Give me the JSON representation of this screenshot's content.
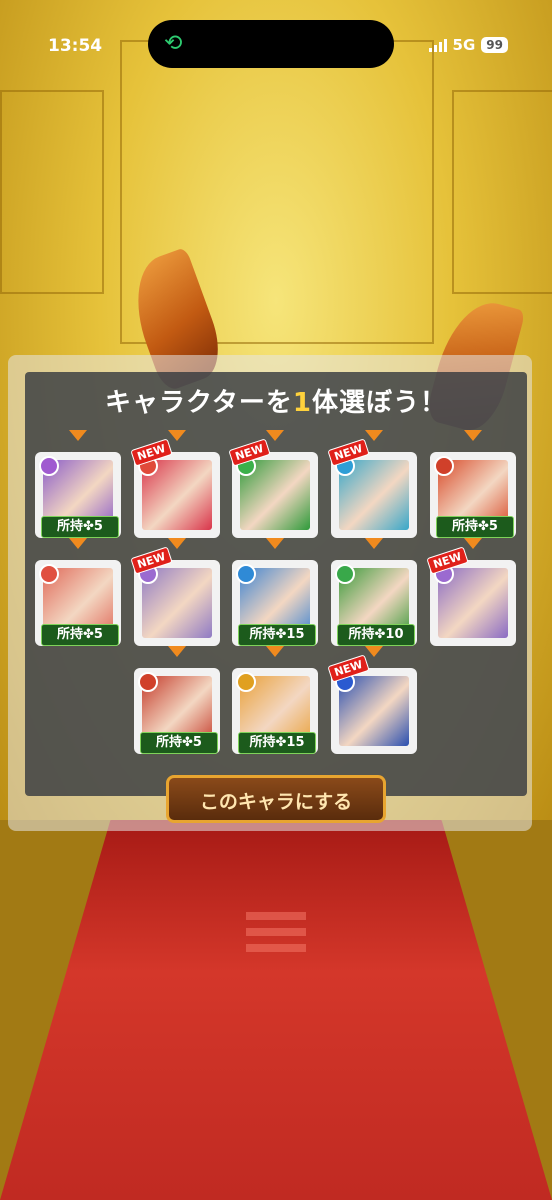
{
  "status_bar": {
    "time": "13:54",
    "network": "5G",
    "battery": "99",
    "island_icon": "app-activity-icon"
  },
  "dialog": {
    "title_before": "キャラクターを",
    "title_number": "1",
    "title_after": "体選ぼう！",
    "select_button": "このキャラにする"
  },
  "characters": [
    {
      "name": "char-1",
      "owned": "所持✤5",
      "new": false,
      "color": "#8a5cc9",
      "orb": "#a05ad0"
    },
    {
      "name": "char-2",
      "owned": "",
      "new": true,
      "color": "#d9344a",
      "orb": "#e04a3a"
    },
    {
      "name": "char-3",
      "owned": "",
      "new": true,
      "color": "#2e9a3a",
      "orb": "#3bb04a"
    },
    {
      "name": "char-4",
      "owned": "",
      "new": true,
      "color": "#37a7c9",
      "orb": "#2f9ed6"
    },
    {
      "name": "char-5",
      "owned": "所持✤5",
      "new": false,
      "color": "#d84a2a",
      "orb": "#d0402a"
    },
    {
      "name": "char-6",
      "owned": "所持✤5",
      "new": false,
      "color": "#e06a5a",
      "orb": "#e05040"
    },
    {
      "name": "char-7",
      "owned": "",
      "new": true,
      "color": "#8f7ac4",
      "orb": "#9b6ad0"
    },
    {
      "name": "char-8",
      "owned": "所持✤15",
      "new": false,
      "color": "#3f84d1",
      "orb": "#2f8ad6"
    },
    {
      "name": "char-9",
      "owned": "所持✤10",
      "new": false,
      "color": "#3a9a3a",
      "orb": "#39a84a"
    },
    {
      "name": "char-10",
      "owned": "",
      "new": true,
      "color": "#8a6bc4",
      "orb": "#9b6ad0"
    },
    {
      "name": "char-11",
      "owned": "所持✤5",
      "new": false,
      "color": "#c43a2a",
      "orb": "#d0402a"
    },
    {
      "name": "char-12",
      "owned": "所持✤15",
      "new": false,
      "color": "#e9a13a",
      "orb": "#e0a020"
    },
    {
      "name": "char-13",
      "owned": "",
      "new": true,
      "color": "#2a4fb0",
      "orb": "#2a5ad0"
    }
  ],
  "labels": {
    "new_badge": "NEW"
  },
  "colors": {
    "accent": "#ffd23c",
    "badge_green": "#1c5b1c",
    "arrow": "#f08a1e"
  }
}
